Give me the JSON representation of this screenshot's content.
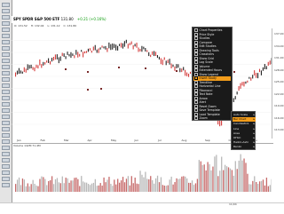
{
  "chart": {
    "symbol": "SPY SPDR S&P 500 ETF",
    "last": "131.80",
    "change": "+0.21 (+0.16%)",
    "ohlc": [
      "O: 131.52",
      "H: 132.04",
      "L: 131.12",
      "C: 131.80"
    ],
    "volume_label": "Volume 142M 71.4M",
    "y_ticks": [
      "137.00",
      "134.00",
      "131.00",
      "128.00",
      "125.00",
      "122.00",
      "119.00",
      "116.00",
      "113.00"
    ],
    "x_ticks": [
      "Jan",
      "Feb",
      "Mar",
      "Apr",
      "May",
      "Jun",
      "Jul",
      "Aug",
      "Sep",
      "Oct",
      "Nov"
    ],
    "date": "11/04"
  },
  "context_menu": {
    "items": [
      "Chart Properties",
      "Price Style",
      "Studies",
      "Compare",
      "Edit Studies",
      "Drawing Tools",
      "Crosshairs",
      "Show Grid",
      "Log Scale",
      "Volume",
      "Extended Hours",
      "Show Legend",
      "Insert Study",
      "Trendline",
      "Horizontal Line",
      "Fibonacci",
      "Text Note",
      "Arrow",
      "Alert",
      "Reset Zoom",
      "Save Template",
      "Load Template",
      "Zoom"
    ],
    "highlighted_index": 12
  },
  "submenu": {
    "items": [
      "Auto Scale",
      "Bar Chart",
      "Candlestick",
      "Line",
      "Area",
      "OHLC",
      "Heikin-Ashi",
      "Renko"
    ],
    "highlighted_index": 1
  }
}
